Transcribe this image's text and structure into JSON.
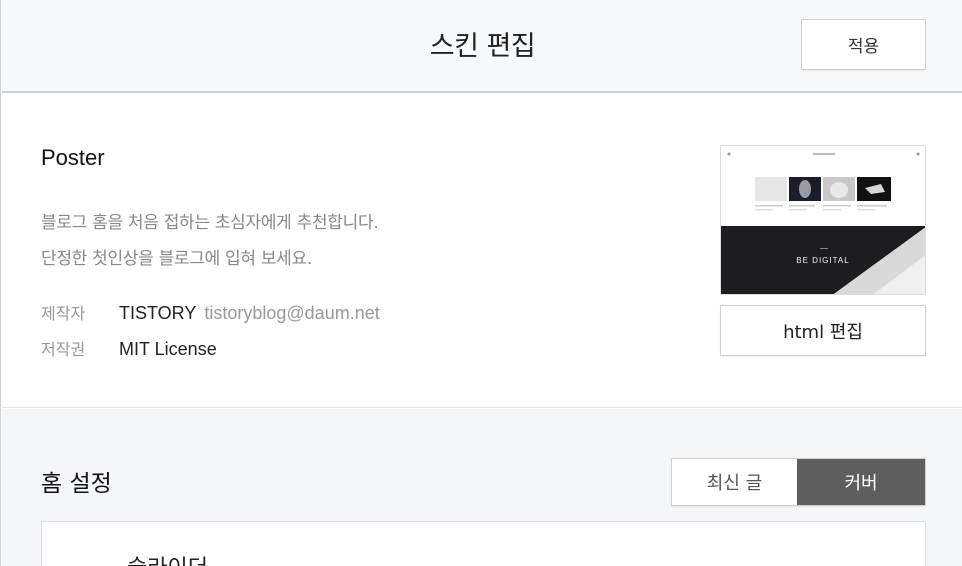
{
  "header": {
    "title": "스킨 편집",
    "apply_label": "적용"
  },
  "skin": {
    "name": "Poster",
    "description": [
      "블로그 홈을 처음 접하는 초심자에게 추천합니다.",
      "단정한 첫인상을 블로그에 입혀 보세요."
    ],
    "author_key": "제작자",
    "author_name": "TISTORY",
    "author_email": "tistoryblog@daum.net",
    "license_key": "저작권",
    "license_value": "MIT License",
    "thumbnail_caption": "BE DIGITAL",
    "html_edit_label": "html 편집"
  },
  "home": {
    "title": "홈 설정",
    "options": [
      "최신 글",
      "커버"
    ],
    "selected": "커버",
    "slider_label": "슬라이더"
  },
  "colors": {
    "header_bg": "#f7f8fa",
    "selected_bg": "#5e5e5e",
    "section_bg": "#f4f5f7"
  }
}
